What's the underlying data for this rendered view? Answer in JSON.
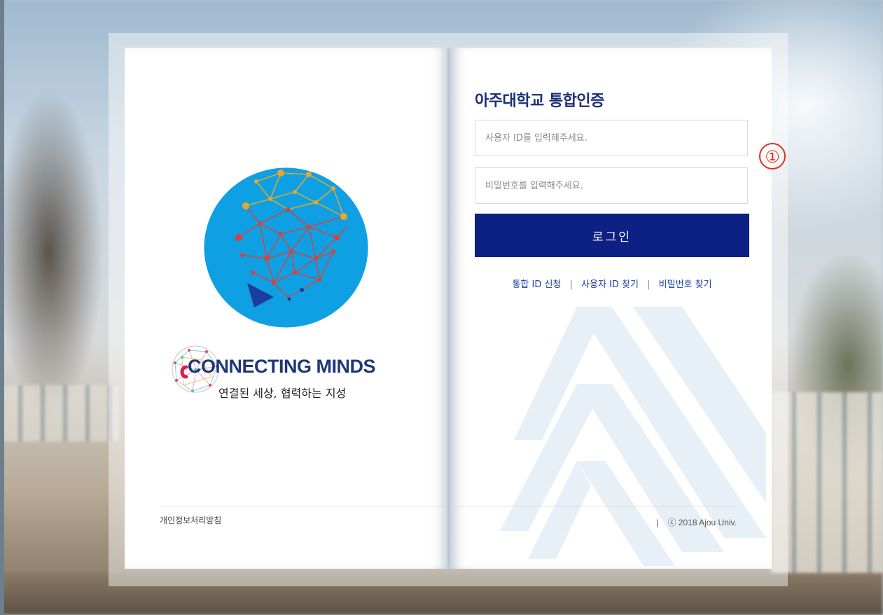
{
  "login": {
    "title": "아주대학교 통합인증",
    "id_placeholder": "사용자 ID를 입력해주세요.",
    "password_placeholder": "비밀번호를 입력해주세요.",
    "login_button": "로그인"
  },
  "links": {
    "register": "통합 ID 신청",
    "find_id": "사용자 ID 찾기",
    "find_password": "비밀번호 찾기",
    "separator": "|"
  },
  "branding": {
    "logo_icon": "network-brain-logo-icon",
    "slogan_title": "CONNECTING MINDS",
    "slogan_subtitle": "연결된 세상, 협력하는 지성"
  },
  "footer": {
    "privacy_policy": "개인정보처리방침",
    "separator": "|",
    "copyright": "ⓒ 2018 Ajou Univ."
  },
  "annotation": {
    "marker": "①"
  },
  "colors": {
    "primary": "#0d2084",
    "title": "#1b2e78",
    "link": "#1b3da0",
    "logo_circle": "#0ea0e3",
    "marker": "#e0301e"
  }
}
